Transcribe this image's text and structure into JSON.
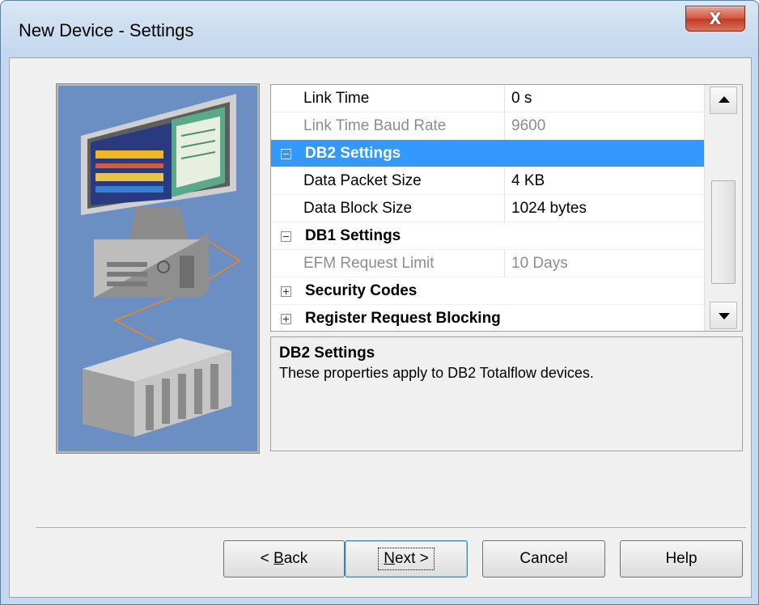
{
  "window": {
    "title": "New Device - Settings",
    "close_glyph": "X"
  },
  "properties": {
    "rows": [
      {
        "type": "property",
        "name": "Link Time",
        "value": "0 s",
        "disabled": false
      },
      {
        "type": "property",
        "name": "Link Time Baud Rate",
        "value": "9600",
        "disabled": true
      },
      {
        "type": "category",
        "name": "DB2 Settings",
        "expanded": true,
        "selected": true
      },
      {
        "type": "property",
        "name": "Data Packet Size",
        "value": "4 KB",
        "disabled": false
      },
      {
        "type": "property",
        "name": "Data Block Size",
        "value": "1024 bytes",
        "disabled": false
      },
      {
        "type": "category",
        "name": "DB1 Settings",
        "expanded": true,
        "selected": false
      },
      {
        "type": "property",
        "name": "EFM Request Limit",
        "value": "10 Days",
        "disabled": true
      },
      {
        "type": "category",
        "name": "Security Codes",
        "expanded": false,
        "selected": false
      },
      {
        "type": "category",
        "name": "Register Request Blocking",
        "expanded": false,
        "selected": false
      }
    ]
  },
  "description": {
    "title": "DB2 Settings",
    "text": "These properties apply to DB2 Totalflow devices."
  },
  "buttons": {
    "back": {
      "pre": "< ",
      "mnemonic": "B",
      "post": "ack"
    },
    "next": {
      "mnemonic": "N",
      "post": "ext >"
    },
    "cancel": "Cancel",
    "help": "Help"
  },
  "colors": {
    "selection": "#3399ff",
    "art_background": "#6b8fc3",
    "disabled_text": "#8d8d8d"
  }
}
